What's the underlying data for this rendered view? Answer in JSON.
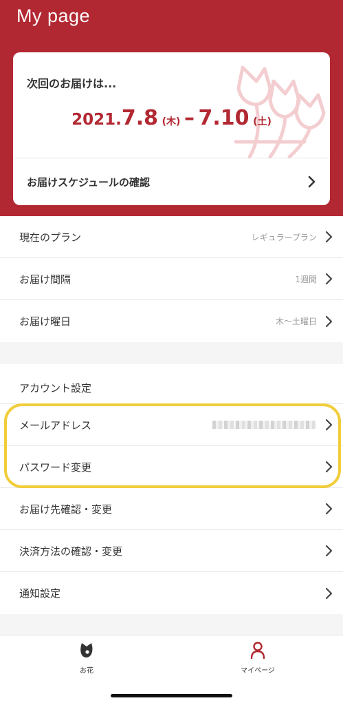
{
  "header": {
    "title": "My page"
  },
  "delivery_card": {
    "next_label": "次回のお届けは...",
    "date": {
      "year": "2021.",
      "start": "7.8",
      "start_weekday": "(木)",
      "separator": "–",
      "end": "7.10",
      "end_weekday": "(土)"
    },
    "schedule_link": "お届けスケジュールの確認"
  },
  "plan_list": [
    {
      "label": "現在のプラン",
      "value": "レギュラープラン"
    },
    {
      "label": "お届け間隔",
      "value": "1週間"
    },
    {
      "label": "お届け曜日",
      "value": "木〜土曜日"
    }
  ],
  "account": {
    "section_title": "アカウント設定",
    "email_label": "メールアドレス",
    "password_label": "パスワード変更",
    "address_label": "お届け先確認・変更",
    "payment_label": "決済方法の確認・変更",
    "notify_label": "通知設定"
  },
  "tabbar": {
    "flower_label": "お花",
    "mypage_label": "マイページ"
  },
  "colors": {
    "brand_red": "#b22832",
    "highlight_yellow": "#f1cd3b"
  },
  "icons": {
    "row_arrow": "chevron-right-icon",
    "flower_tab": "flower-icon",
    "mypage_tab": "person-icon"
  }
}
